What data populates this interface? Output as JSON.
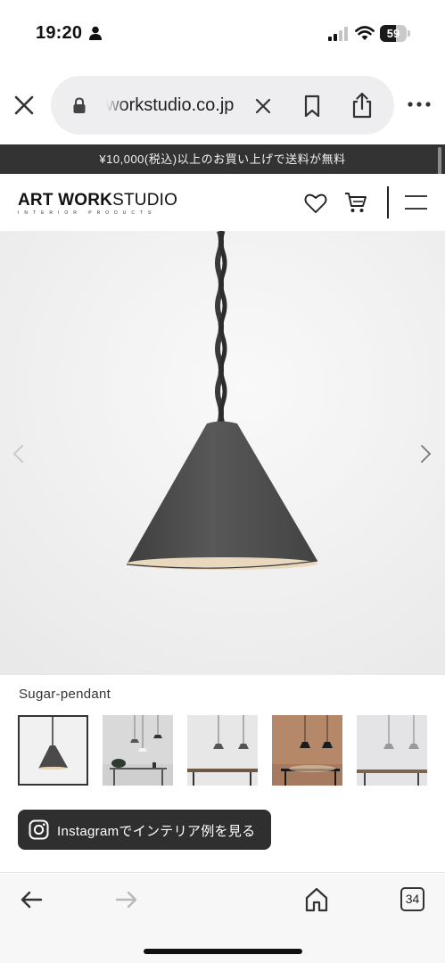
{
  "status_bar": {
    "time": "19:20",
    "battery": "59",
    "battery_level": 0.59,
    "icons": [
      "person-icon",
      "signal-icon",
      "wifi-icon",
      "battery-icon"
    ]
  },
  "browser": {
    "url": "workstudio.co.jp",
    "icons": [
      "close-icon",
      "lock-icon",
      "clear-icon",
      "bookmark-icon",
      "share-icon",
      "more-icon"
    ]
  },
  "announcement": "¥10,000(税込)以上のお買い上げで送料が無料",
  "header": {
    "logo_main_bold": "ART WORK",
    "logo_main_light": "STUDIO",
    "logo_sub": "INTERIOR PRODUCTS",
    "icons": [
      "heart-icon",
      "cart-icon",
      "menu-icon"
    ]
  },
  "product": {
    "name": "Sugar-pendant",
    "thumbnails_count": 5,
    "active_thumbnail": 0
  },
  "instagram_button": {
    "label": "Instagramでインテリア例を見る"
  },
  "bottom_bar": {
    "tab_count": "34",
    "icons": [
      "back-icon",
      "forward-icon",
      "home-icon",
      "tabs-icon"
    ]
  },
  "colors": {
    "announcement_bg": "#333333",
    "lamp_shade": "#4b4b4b",
    "lamp_inner": "#e7d6bc",
    "button_bg": "#2f2f2f"
  }
}
